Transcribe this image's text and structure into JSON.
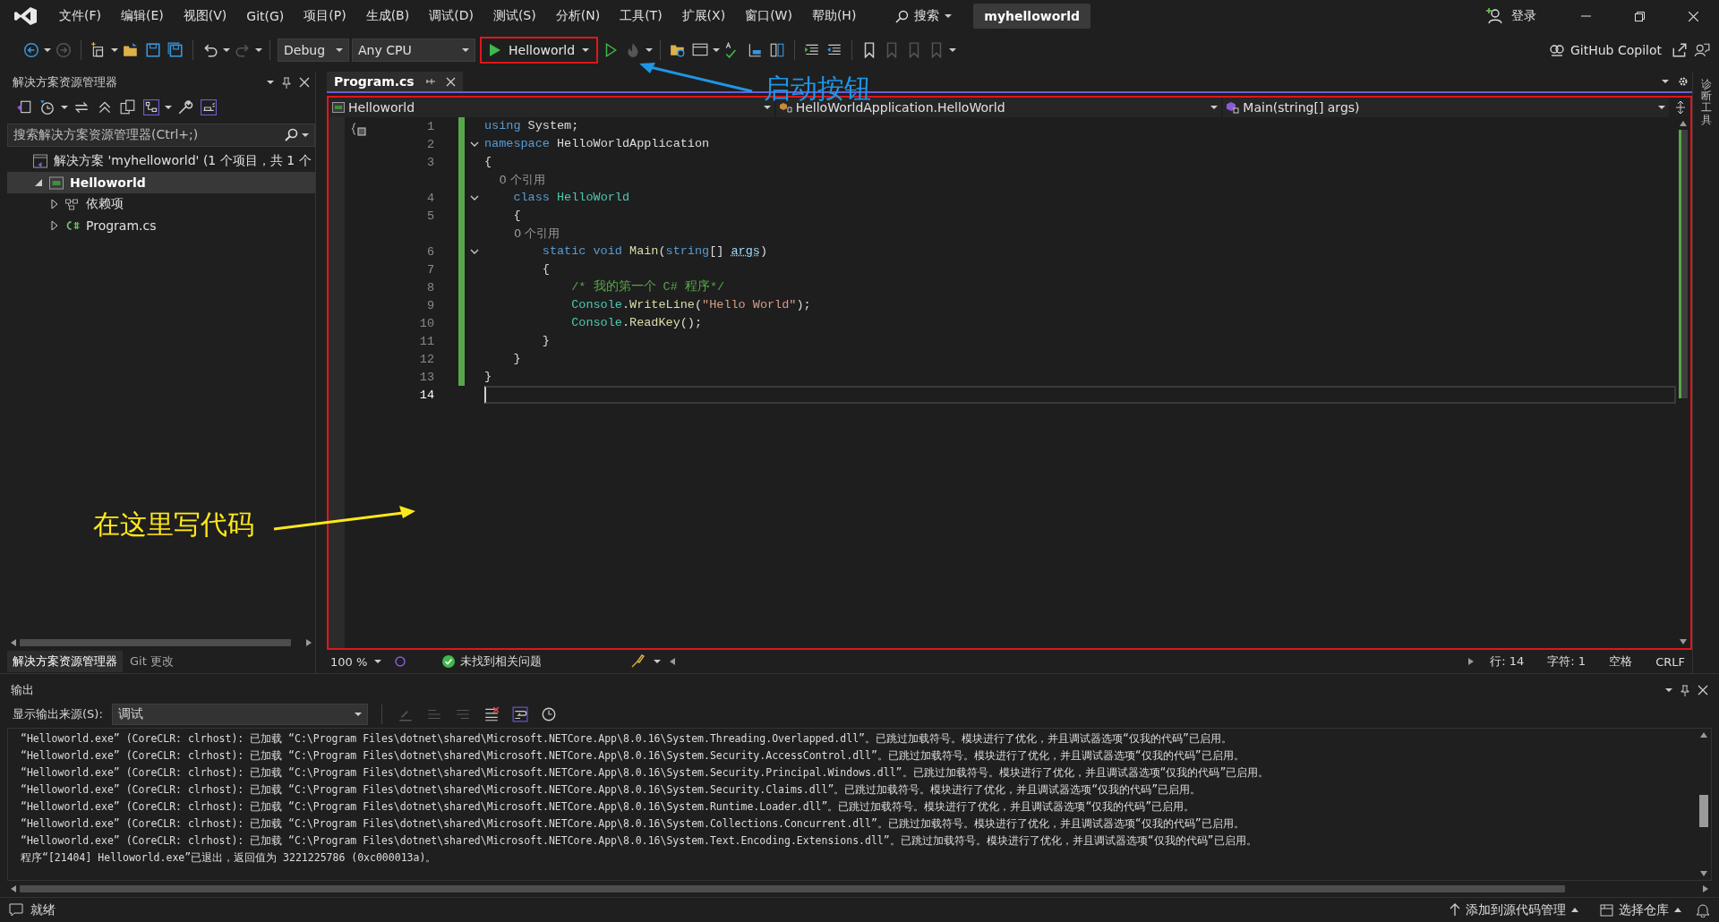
{
  "menu": [
    "文件(F)",
    "编辑(E)",
    "视图(V)",
    "Git(G)",
    "项目(P)",
    "生成(B)",
    "调试(D)",
    "测试(S)",
    "分析(N)",
    "工具(T)",
    "扩展(X)",
    "窗口(W)",
    "帮助(H)"
  ],
  "search": {
    "label": "搜索"
  },
  "solution_name": "myhelloworld",
  "account": {
    "label": "登录"
  },
  "toolbar": {
    "configuration": "Debug",
    "platform": "Any CPU",
    "start_button": {
      "label": "Helloworld",
      "highlighted": true
    },
    "copilot": "GitHub Copilot"
  },
  "solution_explorer": {
    "title": "解决方案资源管理器",
    "search": {
      "placeholder": "搜索解决方案资源管理器(Ctrl+;)"
    },
    "tree": [
      {
        "label": "解决方案 'myhelloworld' (1 个项目，共 1 个",
        "kind": "solution",
        "selected": false,
        "children": [
          {
            "label": "Helloworld",
            "kind": "project",
            "expanded": true,
            "selected": true,
            "children": [
              {
                "label": "依赖项",
                "kind": "dependencies",
                "expanded": false,
                "selected": false
              },
              {
                "label": "Program.cs",
                "kind": "csharp",
                "expanded": false,
                "selected": false
              }
            ]
          }
        ]
      }
    ],
    "tabs": [
      {
        "label": "解决方案资源管理器",
        "selected": true
      },
      {
        "label": "Git 更改",
        "selected": false
      }
    ]
  },
  "editor": {
    "highlighted": true,
    "tabs": [
      {
        "label": "Program.cs",
        "selected": true
      }
    ],
    "nav": [
      "Helloworld",
      "HelloWorldApplication.HelloWorld",
      "Main(string[] args)"
    ],
    "lines": [
      {
        "kind": "code",
        "number": "1",
        "fold": false,
        "current": false,
        "tokens": [
          {
            "text": "using",
            "kind": "kw"
          },
          {
            "text": " System;",
            "kind": "plain"
          }
        ]
      },
      {
        "kind": "code",
        "number": "2",
        "fold": true,
        "current": false,
        "tokens": [
          {
            "text": "namespace",
            "kind": "kw"
          },
          {
            "text": " HelloWorldApplication",
            "kind": "plain"
          }
        ]
      },
      {
        "kind": "code",
        "number": "3",
        "fold": false,
        "current": false,
        "tokens": [
          {
            "text": "{",
            "kind": "plain"
          }
        ]
      },
      {
        "kind": "codelens",
        "text": "    0 个引用"
      },
      {
        "kind": "code",
        "number": "4",
        "fold": true,
        "current": false,
        "tokens": [
          {
            "text": "    class",
            "kind": "kw"
          },
          {
            "text": " HelloWorld",
            "kind": "type"
          }
        ]
      },
      {
        "kind": "code",
        "number": "5",
        "fold": false,
        "current": false,
        "tokens": [
          {
            "text": "    {",
            "kind": "plain"
          }
        ]
      },
      {
        "kind": "codelens",
        "text": "        0 个引用"
      },
      {
        "kind": "code",
        "number": "6",
        "fold": true,
        "current": false,
        "tokens": [
          {
            "text": "        static void",
            "kind": "kw"
          },
          {
            "text": " Main",
            "kind": "method"
          },
          {
            "text": "(",
            "kind": "plain"
          },
          {
            "text": "string",
            "kind": "kw"
          },
          {
            "text": "[] ",
            "kind": "plain"
          },
          {
            "text": "args",
            "kind": "param"
          },
          {
            "text": ")",
            "kind": "plain"
          }
        ]
      },
      {
        "kind": "code",
        "number": "7",
        "fold": false,
        "current": false,
        "tokens": [
          {
            "text": "        {",
            "kind": "plain"
          }
        ]
      },
      {
        "kind": "code",
        "number": "8",
        "fold": false,
        "current": false,
        "tokens": [
          {
            "text": "            /* 我的第一个 C# 程序*/",
            "kind": "comment"
          }
        ]
      },
      {
        "kind": "code",
        "number": "9",
        "fold": false,
        "current": false,
        "tokens": [
          {
            "text": "            Console",
            "kind": "type"
          },
          {
            "text": ".",
            "kind": "plain"
          },
          {
            "text": "WriteLine",
            "kind": "method"
          },
          {
            "text": "(",
            "kind": "plain"
          },
          {
            "text": "\"Hello World\"",
            "kind": "string"
          },
          {
            "text": ");",
            "kind": "plain"
          }
        ]
      },
      {
        "kind": "code",
        "number": "10",
        "fold": false,
        "current": false,
        "tokens": [
          {
            "text": "            Console",
            "kind": "type"
          },
          {
            "text": ".",
            "kind": "plain"
          },
          {
            "text": "ReadKey",
            "kind": "method"
          },
          {
            "text": "();",
            "kind": "plain"
          }
        ]
      },
      {
        "kind": "code",
        "number": "11",
        "fold": false,
        "current": false,
        "tokens": [
          {
            "text": "        }",
            "kind": "plain"
          }
        ]
      },
      {
        "kind": "code",
        "number": "12",
        "fold": false,
        "current": false,
        "tokens": [
          {
            "text": "    }",
            "kind": "plain"
          }
        ]
      },
      {
        "kind": "code",
        "number": "13",
        "fold": false,
        "current": false,
        "tokens": [
          {
            "text": "}",
            "kind": "plain"
          }
        ]
      },
      {
        "kind": "code",
        "number": "14",
        "fold": false,
        "current": true
      }
    ],
    "status": {
      "zoom": "100 %",
      "issues": "未找到相关问题",
      "line": "行: 14",
      "column": "字符: 1",
      "whitespace": "空格",
      "line_ending": "CRLF"
    }
  },
  "side_strip": "诊断工具",
  "output": {
    "title": "输出",
    "source_label": "显示输出来源(S):",
    "source": "调试",
    "lines": [
      "“Helloworld.exe” (CoreCLR: clrhost): 已加载 “C:\\Program Files\\dotnet\\shared\\Microsoft.NETCore.App\\8.0.16\\System.Threading.Overlapped.dll”。已跳过加载符号。模块进行了优化，并且调试器选项“仅我的代码”已启用。",
      "“Helloworld.exe” (CoreCLR: clrhost): 已加载 “C:\\Program Files\\dotnet\\shared\\Microsoft.NETCore.App\\8.0.16\\System.Security.AccessControl.dll”。已跳过加载符号。模块进行了优化，并且调试器选项“仅我的代码”已启用。",
      "“Helloworld.exe” (CoreCLR: clrhost): 已加载 “C:\\Program Files\\dotnet\\shared\\Microsoft.NETCore.App\\8.0.16\\System.Security.Principal.Windows.dll”。已跳过加载符号。模块进行了优化，并且调试器选项“仅我的代码”已启用。",
      "“Helloworld.exe” (CoreCLR: clrhost): 已加载 “C:\\Program Files\\dotnet\\shared\\Microsoft.NETCore.App\\8.0.16\\System.Security.Claims.dll”。已跳过加载符号。模块进行了优化，并且调试器选项“仅我的代码”已启用。",
      "“Helloworld.exe” (CoreCLR: clrhost): 已加载 “C:\\Program Files\\dotnet\\shared\\Microsoft.NETCore.App\\8.0.16\\System.Runtime.Loader.dll”。已跳过加载符号。模块进行了优化，并且调试器选项“仅我的代码”已启用。",
      "“Helloworld.exe” (CoreCLR: clrhost): 已加载 “C:\\Program Files\\dotnet\\shared\\Microsoft.NETCore.App\\8.0.16\\System.Collections.Concurrent.dll”。已跳过加载符号。模块进行了优化，并且调试器选项“仅我的代码”已启用。",
      "“Helloworld.exe” (CoreCLR: clrhost): 已加载 “C:\\Program Files\\dotnet\\shared\\Microsoft.NETCore.App\\8.0.16\\System.Text.Encoding.Extensions.dll”。已跳过加载符号。模块进行了优化，并且调试器选项“仅我的代码”已启用。",
      "程序“[21404] Helloworld.exe”已退出，返回值为 3221225786 (0xc000013a)。"
    ]
  },
  "status_bar": {
    "state": "就绪",
    "source_control": "添加到源代码管理",
    "repository": "选择仓库"
  },
  "callouts": [
    {
      "text": "启动按钮",
      "color": "#1e96e6"
    },
    {
      "text": "在这里写代码",
      "color": "#ffe81a"
    }
  ]
}
